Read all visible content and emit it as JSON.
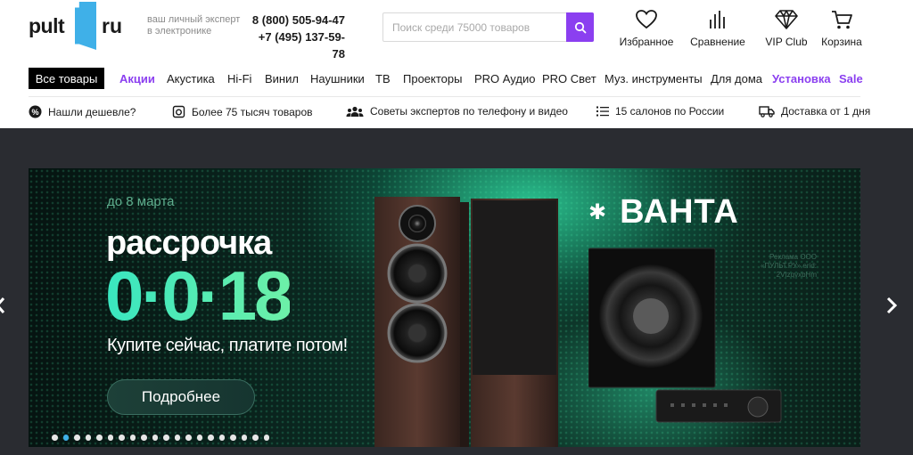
{
  "header": {
    "logo": {
      "left": "pult",
      "right": "ru"
    },
    "tagline": "ваш личный эксперт в электронике",
    "phones": [
      "8 (800) 505-94-47",
      "+7 (495) 137-59-78"
    ],
    "search": {
      "placeholder": "Поиск среди 75000 товаров",
      "value": ""
    },
    "icons": [
      {
        "label": "Избранное",
        "icon": "heart-icon"
      },
      {
        "label": "Сравнение",
        "icon": "compare-bars-icon"
      },
      {
        "label": "VIP Club",
        "icon": "diamond-icon"
      },
      {
        "label": "Корзина",
        "icon": "cart-icon"
      }
    ]
  },
  "nav": {
    "all": "Все товары",
    "items": [
      "Акции",
      "Акустика",
      "Hi-Fi",
      "Винил",
      "Наушники",
      "ТВ",
      "Проекторы",
      "PRO Аудио",
      "PRO Свет",
      "Муз. инструменты",
      "Для дома",
      "Установка",
      "Sale"
    ],
    "highlighted": [
      "Акции",
      "Установка",
      "Sale"
    ]
  },
  "features": [
    {
      "label": "Нашли дешевле?",
      "icon": "percent-icon"
    },
    {
      "label": "Более 75 тысяч товаров",
      "icon": "box-icon"
    },
    {
      "label": "Советы экспертов по телефону и видео",
      "icon": "people-icon"
    },
    {
      "label": "15 салонов по России",
      "icon": "list-icon"
    },
    {
      "label": "Доставка от 1 дня",
      "icon": "truck-icon"
    }
  ],
  "banner": {
    "date": "до 8 марта",
    "title": "рассрочка",
    "big": "0·0·18",
    "subtitle": "Купите сейчас, платите потом!",
    "button": "Подробнее",
    "brand": "ВАНТА",
    "ad_note": "Реклама ООО «ПУЛЬТ.РУ» erid: 2VtzqvxbHm",
    "slides_count": 20,
    "active_slide": 2
  },
  "colors": {
    "accent": "#8b3ff0",
    "logo_blue": "#3fb0e8",
    "banner_green": "#2fd8a0"
  }
}
